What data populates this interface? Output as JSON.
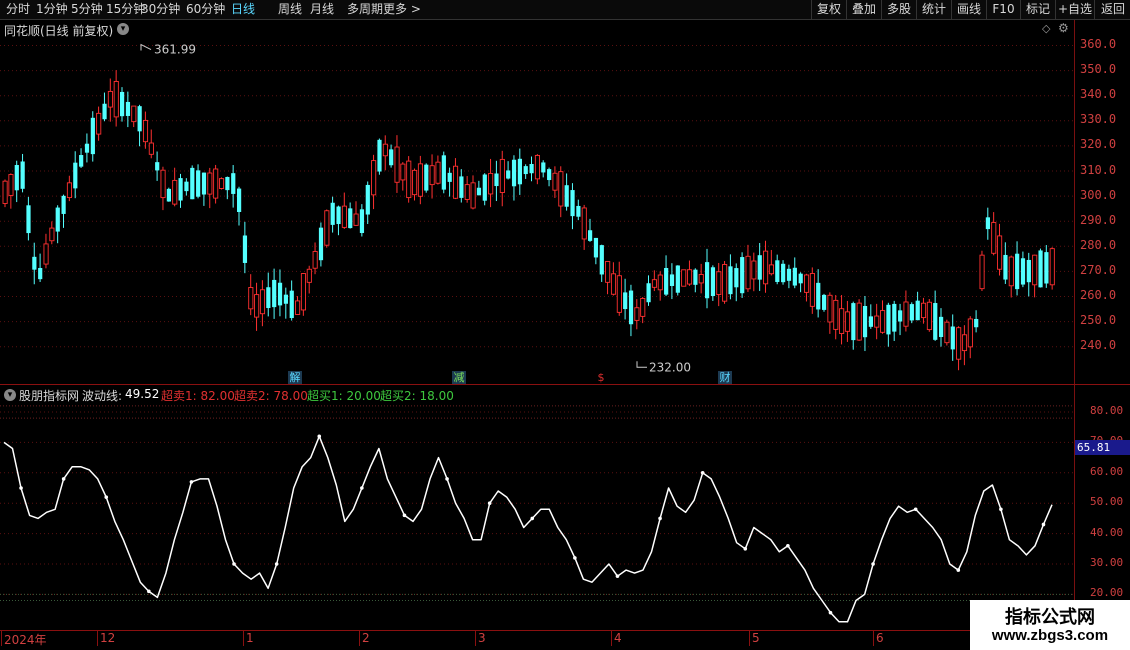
{
  "toolbar": {
    "periods": [
      "分时",
      "1分钟",
      "5分钟",
      "15分钟",
      "30分钟",
      "60分钟",
      "日线",
      "周线",
      "月线",
      "多周期",
      "更多 >"
    ],
    "active_period": "日线",
    "right_buttons": [
      "复权",
      "叠加",
      "多股",
      "统计",
      "画线",
      "F10",
      "标记",
      "+自选",
      "返回"
    ]
  },
  "main_panel": {
    "title": "同花顺(日线 前复权)",
    "high_label": "361.99",
    "low_label": "232.00",
    "y_ticks": [
      "360.0",
      "350.0",
      "340.0",
      "330.0",
      "320.0",
      "310.0",
      "300.0",
      "290.0",
      "280.0",
      "270.0",
      "260.0",
      "250.0",
      "240.0"
    ],
    "events": [
      {
        "text": "解",
        "color": "#5ad8ff"
      },
      {
        "text": "减",
        "color": "#7be05a"
      },
      {
        "text": "$",
        "color": "#e03030"
      },
      {
        "text": "财",
        "color": "#5ad8ff"
      }
    ]
  },
  "indicator_panel": {
    "name": "股朋指标网",
    "wave_label": "波动线:",
    "wave_value": "49.52",
    "params": [
      {
        "text": "超卖1: 82.00",
        "color": "#e03030"
      },
      {
        "text": "超卖2: 78.00",
        "color": "#e03030"
      },
      {
        "text": "超买1: 20.00",
        "color": "#3ec83e"
      },
      {
        "text": "超买2: 18.00",
        "color": "#3ec83e"
      }
    ],
    "y_ticks": [
      "80.00",
      "70.00",
      "60.00",
      "50.00",
      "40.00",
      "30.00",
      "20.00"
    ],
    "current_marker": "65.81"
  },
  "x_axis": {
    "labels": [
      "2024年",
      "12",
      "1",
      "2",
      "3",
      "4",
      "5",
      "6"
    ]
  },
  "watermark": {
    "title": "指标公式网",
    "url": "www.zbgs3.com"
  },
  "chart_data": [
    {
      "type": "candlestick",
      "title": "同花顺(日线 前复权)",
      "ylim": [
        232,
        362
      ],
      "series": [
        {
          "name": "high",
          "values": [
            361.99
          ]
        },
        {
          "name": "low",
          "values": [
            232.0
          ]
        }
      ]
    },
    {
      "type": "line",
      "series": [
        {
          "name": "波动线",
          "values": [
            70,
            68,
            55,
            46,
            45,
            47,
            48,
            58,
            62,
            62,
            61,
            58,
            52,
            44,
            38,
            31,
            24,
            21,
            19,
            27,
            38,
            47,
            57,
            58,
            58,
            49,
            38,
            30,
            27,
            25,
            27,
            22,
            30,
            42,
            55,
            62,
            65,
            72,
            65,
            56,
            44,
            48,
            55,
            62,
            68,
            58,
            52,
            46,
            44,
            48,
            58,
            65,
            58,
            50,
            45,
            38,
            38,
            50,
            54,
            52,
            48,
            42,
            45,
            48,
            48,
            42,
            38,
            32,
            25,
            24,
            27,
            30,
            26,
            28,
            27,
            28,
            34,
            45,
            55,
            49,
            47,
            51,
            60,
            58,
            52,
            45,
            37,
            35,
            42,
            40,
            38,
            34,
            36,
            32,
            28,
            22,
            18,
            14,
            11,
            11,
            18,
            20,
            30,
            38,
            45,
            49,
            47,
            48,
            45,
            42,
            38,
            30,
            28,
            34,
            46,
            54,
            56,
            48,
            38,
            36,
            33,
            36,
            43,
            49.52
          ]
        }
      ],
      "ylim": [
        10,
        85
      ],
      "reference_levels": [
        82,
        78,
        20,
        18
      ]
    }
  ]
}
